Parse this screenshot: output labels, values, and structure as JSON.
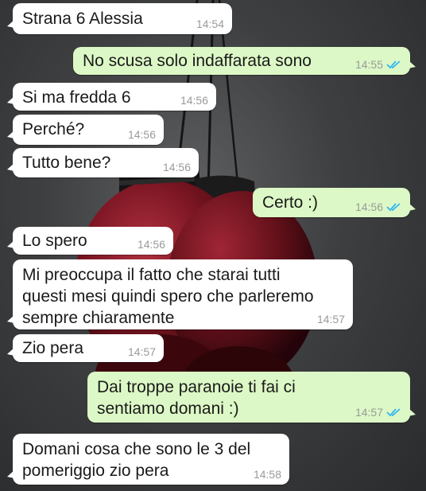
{
  "colors": {
    "incoming_bubble": "#ffffff",
    "outgoing_bubble": "#dcf8c6",
    "read_ticks": "#34b7f1",
    "timestamp": "#9a9a9a"
  },
  "messages": [
    {
      "text": "Strana 6 Alessia",
      "time": "14:54",
      "direction": "incoming"
    },
    {
      "text": "No scusa solo indaffarata sono",
      "time": "14:55",
      "direction": "outgoing",
      "status_icon": "double-check-read-icon"
    },
    {
      "text": "Si ma fredda 6",
      "time": "14:56",
      "direction": "incoming"
    },
    {
      "text": "Perché?",
      "time": "14:56",
      "direction": "incoming"
    },
    {
      "text": "Tutto bene?",
      "time": "14:56",
      "direction": "incoming"
    },
    {
      "text": "Certo :)",
      "time": "14:56",
      "direction": "outgoing",
      "status_icon": "double-check-read-icon"
    },
    {
      "text": "Lo spero",
      "time": "14:56",
      "direction": "incoming"
    },
    {
      "text": "Mi preoccupa il fatto che starai tutti\nquesti mesi quindi spero che parleremo\nsempre chiaramente",
      "time": "14:57",
      "direction": "incoming"
    },
    {
      "text": "Zio pera",
      "time": "14:57",
      "direction": "incoming"
    },
    {
      "text": "Dai troppe paranoie ti fai ci\nsentiamo domani :)",
      "time": "14:57",
      "direction": "outgoing",
      "status_icon": "double-check-read-icon"
    },
    {
      "text": "Domani cosa che sono le 3 del\npomeriggio zio pera",
      "time": "14:58",
      "direction": "incoming"
    }
  ]
}
